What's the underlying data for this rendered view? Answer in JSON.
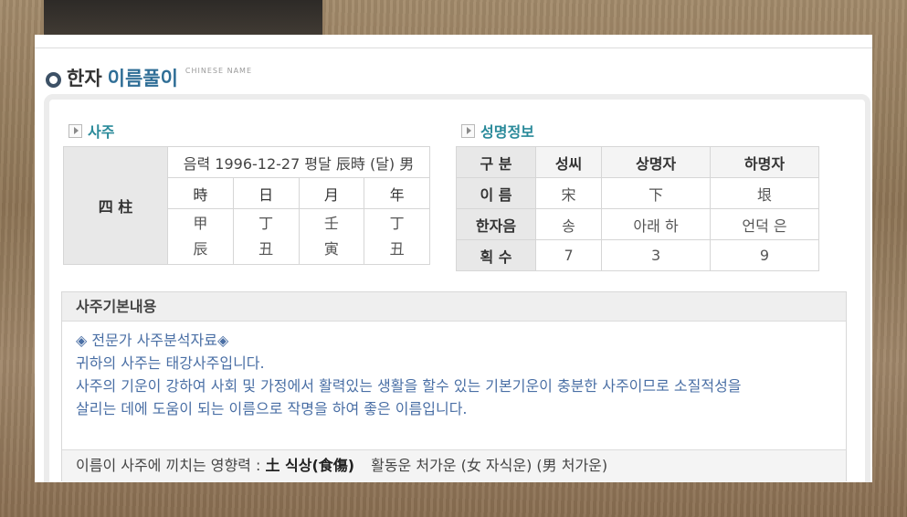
{
  "page": {
    "title_main": "한자",
    "title_accent": "이름풀이",
    "title_sub": "CHINESE NAME"
  },
  "saju": {
    "heading": "사주",
    "label": "四 柱",
    "date_line": "음력 1996-12-27 평달 辰時 (달) 男",
    "columns": [
      "時",
      "日",
      "月",
      "年"
    ],
    "heavenly": [
      "甲",
      "丁",
      "壬",
      "丁"
    ],
    "earthly": [
      "辰",
      "丑",
      "寅",
      "丑"
    ]
  },
  "name_info": {
    "heading": "성명정보",
    "columns": [
      "구 분",
      "성씨",
      "상명자",
      "하명자"
    ],
    "rows": [
      {
        "label": "이 름",
        "values": [
          "宋",
          "下",
          "垠"
        ]
      },
      {
        "label": "한자음",
        "values": [
          "송",
          "아래 하",
          "언덕 은"
        ]
      },
      {
        "label": "획 수",
        "values": [
          "7",
          "3",
          "9"
        ]
      }
    ]
  },
  "basic": {
    "heading": "사주기본내용",
    "lines": [
      "◈ 전문가 사주분석자료◈",
      "귀하의 사주는 태강사주입니다.",
      "사주의 기운이 강하여 사회 및 가정에서 활력있는 생활을 할수 있는 기본기운이 충분한 사주이므로 소질적성을",
      "살리는 데에 도움이 되는 이름으로 작명을 하여 좋은 이름입니다."
    ],
    "footer_label": "이름이 사주에 끼치는 영향력 : ",
    "footer_element": "土 식상(食傷)",
    "footer_rest": "활동운 처가운 (女 자식운) (男 처가운)"
  }
}
